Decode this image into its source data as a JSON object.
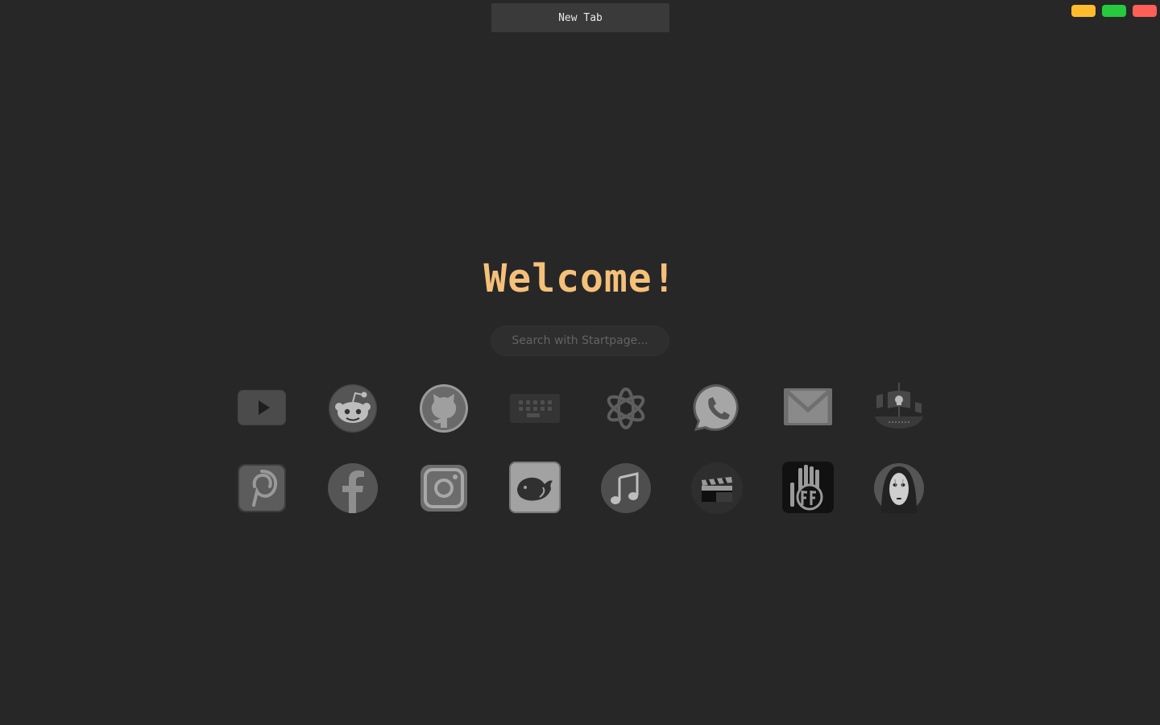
{
  "tab": {
    "label": "New Tab"
  },
  "window_controls": {
    "minimize_color": "#ffbd2e",
    "maximize_color": "#27c93f",
    "close_color": "#ff5f57"
  },
  "welcome": {
    "text": "Welcome!",
    "color": "#f5c07a"
  },
  "search": {
    "placeholder": "Search with Startpage..."
  },
  "shortcuts": [
    {
      "icon": "youtube-icon"
    },
    {
      "icon": "reddit-icon"
    },
    {
      "icon": "github-icon"
    },
    {
      "icon": "keyboard-icon"
    },
    {
      "icon": "openai-icon"
    },
    {
      "icon": "whatsapp-icon"
    },
    {
      "icon": "gmail-icon"
    },
    {
      "icon": "pirate-ship-icon"
    },
    {
      "icon": "pinterest-icon"
    },
    {
      "icon": "facebook-icon"
    },
    {
      "icon": "instagram-icon"
    },
    {
      "icon": "deepseek-icon"
    },
    {
      "icon": "music-icon"
    },
    {
      "icon": "movie-clapper-icon"
    },
    {
      "icon": "hand-logo-icon"
    },
    {
      "icon": "no-face-icon"
    }
  ]
}
